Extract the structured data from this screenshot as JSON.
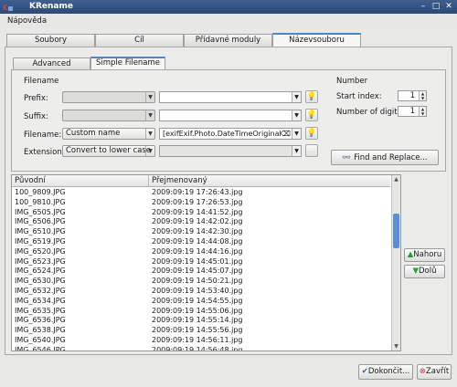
{
  "window": {
    "title": "KRename"
  },
  "menubar": {
    "help": "Nápověda"
  },
  "main_tabs": [
    "Soubory",
    "Cíl",
    "Přídavné moduly",
    "Názevsouboru"
  ],
  "sub_tabs": [
    "Advanced Filename",
    "Simple Filename"
  ],
  "filename_group": {
    "title": "Filename",
    "prefix_label": "Prefix:",
    "suffix_label": "Suffix:",
    "filename_label": "Filename:",
    "filename_mode": "Custom name",
    "filename_value": "[exifExif.Photo.DateTimeOriginal]",
    "extension_label": "Extension:",
    "extension_mode": "Convert to lower case"
  },
  "number_group": {
    "title": "Number",
    "start_index_label": "Start  index:",
    "start_index_value": "1",
    "digits_label": "Number of digits:",
    "digits_value": "1"
  },
  "find_replace_label": "Find and Replace...",
  "list": {
    "col_original": "Původní",
    "col_renamed": "Přejmenovaný",
    "rows": [
      [
        "100_9809.JPG",
        "2009:09:19 17:26:43.jpg"
      ],
      [
        "100_9810.JPG",
        "2009:09:19 17:26:53.jpg"
      ],
      [
        "IMG_6505.JPG",
        "2009:09:19 14:41:52.jpg"
      ],
      [
        "IMG_6506.JPG",
        "2009:09:19 14:42:02.jpg"
      ],
      [
        "IMG_6510.JPG",
        "2009:09:19 14:42:30.jpg"
      ],
      [
        "IMG_6519.JPG",
        "2009:09:19 14:44:08.jpg"
      ],
      [
        "IMG_6520.JPG",
        "2009:09:19 14:44:16.jpg"
      ],
      [
        "IMG_6523.JPG",
        "2009:09:19 14:45:01.jpg"
      ],
      [
        "IMG_6524.JPG",
        "2009:09:19 14:45:07.jpg"
      ],
      [
        "IMG_6530.JPG",
        "2009:09:19 14:50:21.jpg"
      ],
      [
        "IMG_6532.JPG",
        "2009:09:19 14:53:40.jpg"
      ],
      [
        "IMG_6534.JPG",
        "2009:09:19 14:54:55.jpg"
      ],
      [
        "IMG_6535.JPG",
        "2009:09:19 14:55:06.jpg"
      ],
      [
        "IMG_6536.JPG",
        "2009:09:19 14:55:14.jpg"
      ],
      [
        "IMG_6538.JPG",
        "2009:09:19 14:55:56.jpg"
      ],
      [
        "IMG_6540.JPG",
        "2009:09:19 14:56:11.jpg"
      ],
      [
        "IMG_6546.JPG",
        "2009:09:19 14:56:48.jpg"
      ]
    ]
  },
  "move_up_label": "Nahoru",
  "move_down_label": "Dolů",
  "finish_label": "Dokončit...",
  "close_label": "Zavřít",
  "colors": {
    "accent": "#4a86c8",
    "title_bar": "#2d4a76",
    "move_arrows": "#2a9a3a",
    "close_red": "#d03030"
  }
}
